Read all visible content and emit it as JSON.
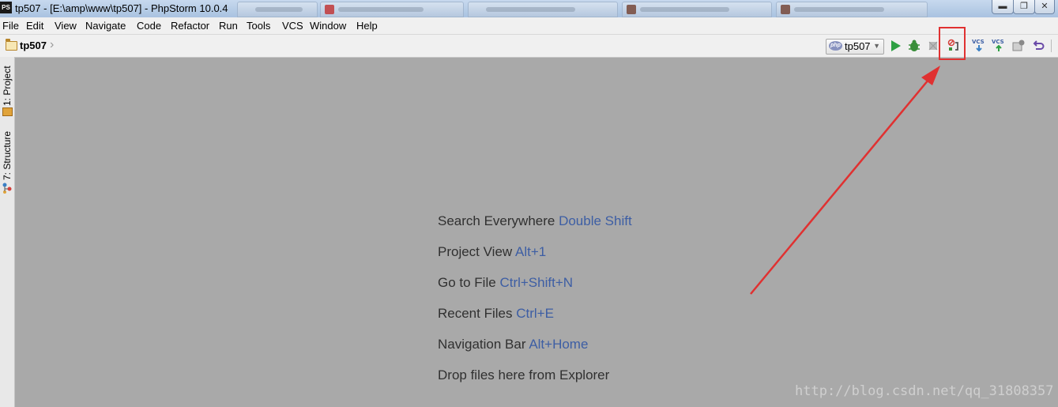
{
  "window": {
    "app_icon": "PS",
    "title": "tp507 - [E:\\amp\\www\\tp507] - PhpStorm 10.0.4"
  },
  "menu": [
    "File",
    "Edit",
    "View",
    "Navigate",
    "Code",
    "Refactor",
    "Run",
    "Tools",
    "VCS",
    "Window",
    "Help"
  ],
  "navbar": {
    "breadcrumb": "tp507",
    "run_config": "tp507",
    "run_config_icon": "php"
  },
  "toolbar_icons": [
    "run-icon",
    "debug-icon",
    "stop-icon",
    "listen-php-debug-icon",
    "vcs-update-icon",
    "vcs-commit-icon",
    "vcs-history-icon",
    "vcs-revert-icon"
  ],
  "sidebar": {
    "tabs": [
      {
        "label": "1: Project"
      },
      {
        "label": "7: Structure"
      }
    ]
  },
  "hints": [
    {
      "text": "Search Everywhere",
      "key": "Double Shift"
    },
    {
      "text": "Project View",
      "key": "Alt+1"
    },
    {
      "text": "Go to File",
      "key": "Ctrl+Shift+N"
    },
    {
      "text": "Recent Files",
      "key": "Ctrl+E"
    },
    {
      "text": "Navigation Bar",
      "key": "Alt+Home"
    },
    {
      "text": "Drop files here from Explorer",
      "key": ""
    }
  ],
  "watermark": "http://blog.csdn.net/qq_31808357",
  "colors": {
    "hint_key": "#3d5ea4",
    "annotation": "#e03131",
    "editor_bg": "#a9a9a9"
  }
}
